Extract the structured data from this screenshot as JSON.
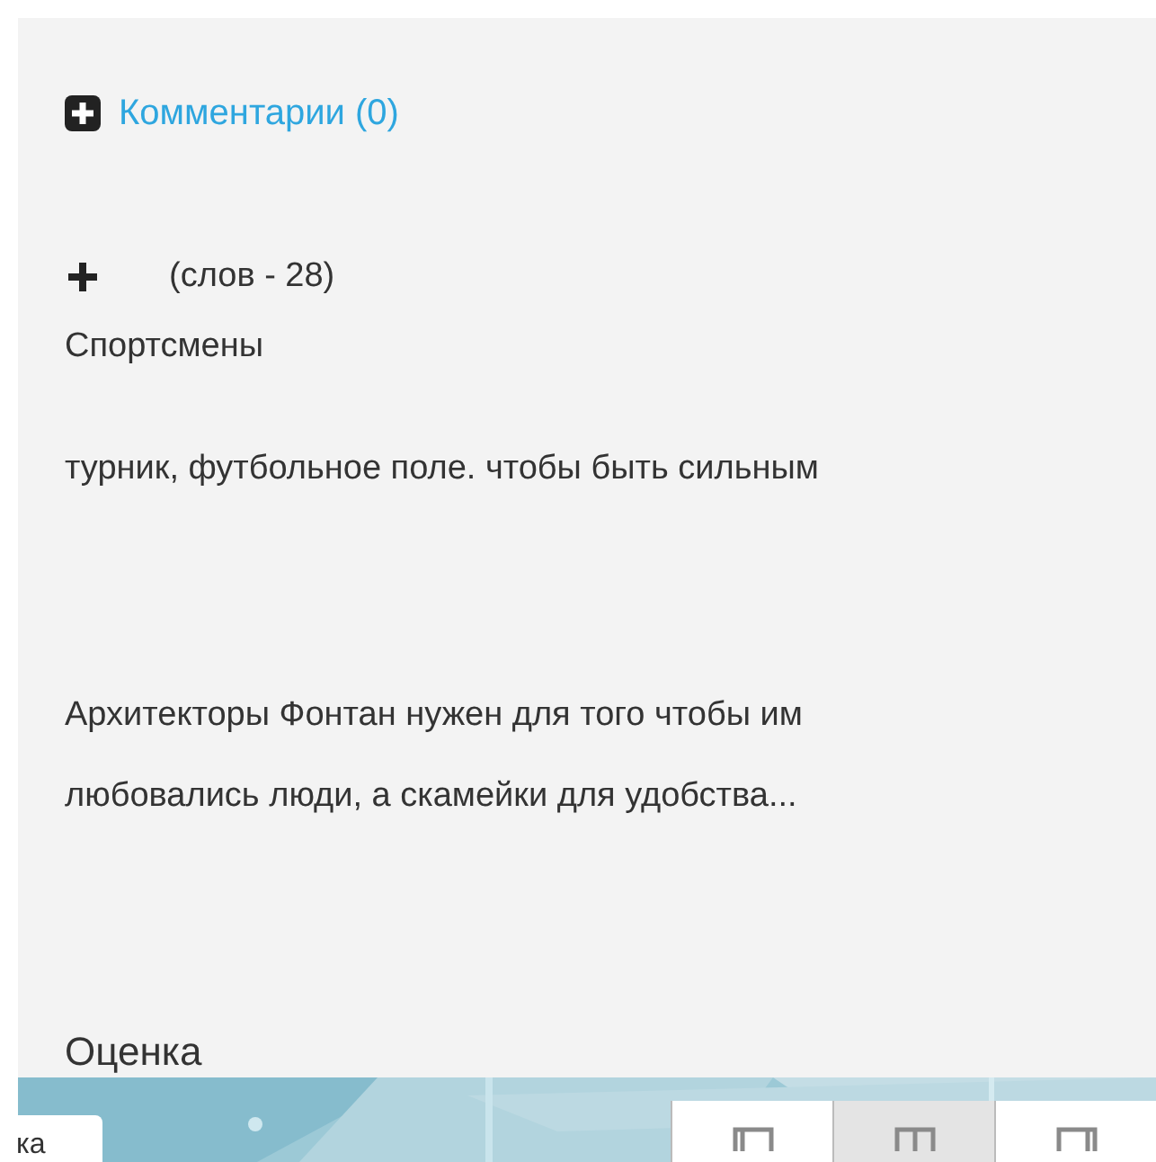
{
  "comments_link": {
    "label": "Комментарии (0)"
  },
  "word_count": "(слов - 28)",
  "paragraphs": [
    "Спортсмены",
    "турник, футбольное поле. чтобы быть сильным",
    "Архитекторы  Фонтан нужен для того чтобы им любовались люди, а скамейки для удобства..."
  ],
  "rating_label": "Оценка",
  "bottom_tab": {
    "label": "ка"
  },
  "layout_buttons": [
    {
      "kind": "left",
      "selected": false
    },
    {
      "kind": "center",
      "selected": true
    },
    {
      "kind": "right",
      "selected": false
    }
  ]
}
